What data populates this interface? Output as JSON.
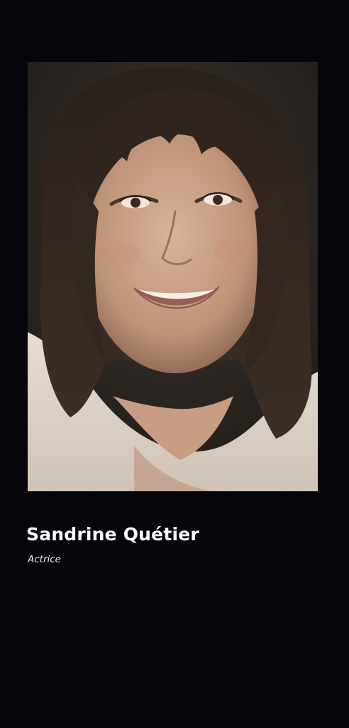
{
  "profile": {
    "name": "Sandrine Quétier",
    "role": "Actrice"
  },
  "colors": {
    "background": "#06050b",
    "text_primary": "#ffffff",
    "text_secondary": "#e9e9ee"
  }
}
